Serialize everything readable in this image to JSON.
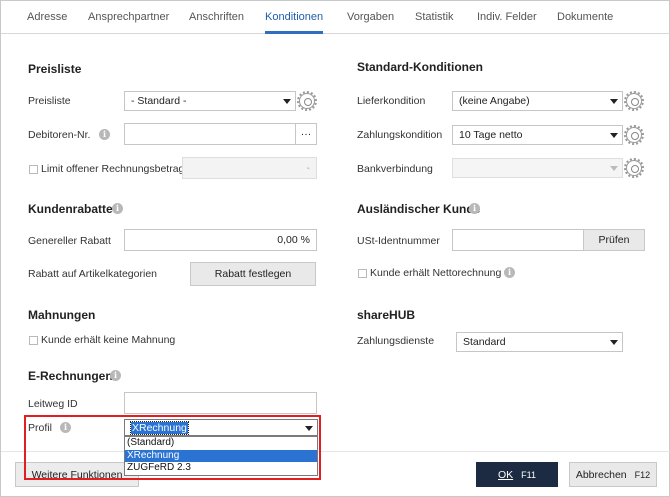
{
  "tabs": [
    {
      "label": "Adresse"
    },
    {
      "label": "Ansprechpartner"
    },
    {
      "label": "Anschriften"
    },
    {
      "label": "Konditionen"
    },
    {
      "label": "Vorgaben"
    },
    {
      "label": "Statistik"
    },
    {
      "label": "Indiv. Felder"
    },
    {
      "label": "Dokumente"
    }
  ],
  "left": {
    "preisliste": {
      "heading": "Preisliste",
      "preisliste_label": "Preisliste",
      "preisliste_value": "- Standard -",
      "debitor_label": "Debitoren-Nr.",
      "debitor_value": "",
      "debitor_button": "···",
      "limit_label": "Limit offener Rechnungsbetrag",
      "limit_button": "-"
    },
    "kundenrabatte": {
      "heading": "Kundenrabatte",
      "genereller_label": "Genereller Rabatt",
      "genereller_value": "0,00 %",
      "artikel_label": "Rabatt auf Artikelkategorien",
      "festlegen_button": "Rabatt festlegen"
    },
    "mahnungen": {
      "heading": "Mahnungen",
      "keine_mahnung_label": "Kunde erhält keine Mahnung"
    },
    "erechnungen": {
      "heading": "E-Rechnungen",
      "leitweg_label": "Leitweg ID",
      "leitweg_value": "",
      "profil_label": "Profil",
      "profil_value": "XRechnung",
      "profil_options": [
        "(Standard)",
        "XRechnung",
        "ZUGFeRD 2.3"
      ]
    }
  },
  "right": {
    "standard": {
      "heading": "Standard-Konditionen",
      "liefer_label": "Lieferkondition",
      "liefer_value": "(keine Angabe)",
      "zahlung_label": "Zahlungskondition",
      "zahlung_value": "10 Tage netto",
      "bank_label": "Bankverbindung",
      "bank_value": ""
    },
    "auslaendisch": {
      "heading": "Ausländischer Kunde",
      "ust_label": "USt-Identnummer",
      "ust_value": "",
      "pruefen_button": "Prüfen",
      "netto_label": "Kunde erhält Nettorechnung"
    },
    "sharehub": {
      "heading": "shareHUB",
      "dienste_label": "Zahlungsdienste",
      "dienste_value": "Standard"
    }
  },
  "footer": {
    "weitere_button": "Weitere Funktionen",
    "ok_button": "OK",
    "ok_key": "F11",
    "abbrechen_button": "Abbrechen",
    "abbrechen_key": "F12"
  },
  "colors": {
    "active_tab": "#2e6fc0",
    "ok_button_bg": "#1c2b41",
    "highlight": "#2a73d2",
    "annotation_box": "#e02020"
  }
}
